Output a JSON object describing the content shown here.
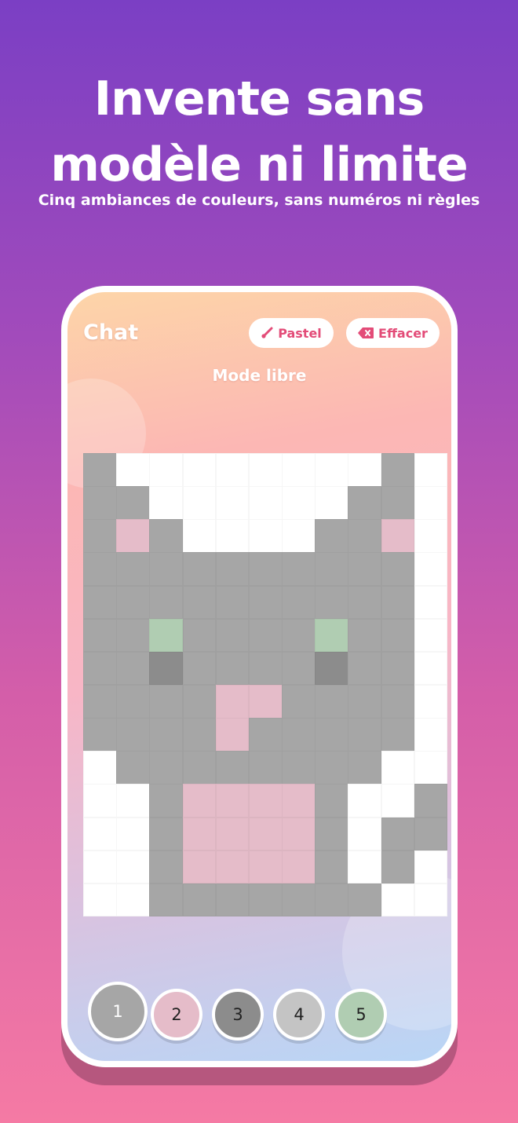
{
  "headline": {
    "line1": "Invente sans",
    "line2": "modèle ni limite"
  },
  "subline": "Cinq ambiances de couleurs, sans numéros ni règles",
  "app": {
    "title": "Chat",
    "mode_label": "Mode libre",
    "pastel_button": {
      "label": "Pastel",
      "icon": "brush-icon"
    },
    "clear_button": {
      "label": "Effacer",
      "icon": "backspace-icon"
    }
  },
  "palette": [
    {
      "number": "1",
      "color": "#a6a6a6",
      "selected": true
    },
    {
      "number": "2",
      "color": "#e5bcc9"
    },
    {
      "number": "3",
      "color": "#8c8c8c"
    },
    {
      "number": "4",
      "color": "#c4c4c4"
    },
    {
      "number": "5",
      "color": "#b0cdb2"
    }
  ],
  "pixel_grid": {
    "columns": 11,
    "rows": 14,
    "colors": {
      "W": "#ffffff",
      "G": "#a6a6a6",
      "D": "#8c8c8c",
      "P": "#e5bcc9",
      "E": "#b0cdb2"
    },
    "rows_data": [
      "GWWWWWWWWGW",
      "GGWWWWWWGGW",
      "GPGWWWWGGPW",
      "GGGGGGGGGGW",
      "GGGGGGGGGGW",
      "GGEGGGGEGGW",
      "GGDGGGGDGGW",
      "GGGGPPGGGGW",
      "GGGGPGGGGGW",
      "WGGGGGGGGWW",
      "WWGPPPPGWWG",
      "WWGPPPPGWGG",
      "WWGPPPPGWGW",
      "WWGGGGGGGWW"
    ]
  }
}
